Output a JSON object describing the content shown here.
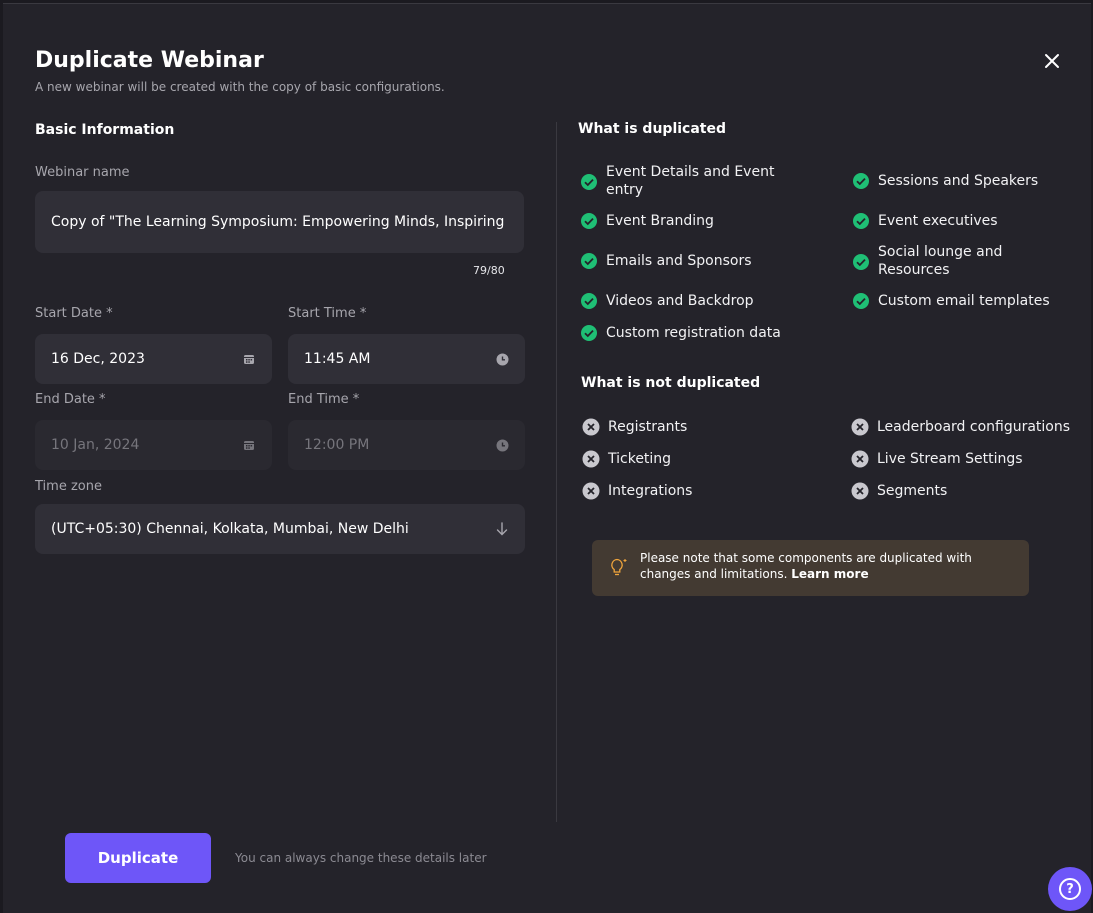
{
  "modal": {
    "title": "Duplicate Webinar",
    "subtitle": "A new webinar will be created with the copy of basic configurations."
  },
  "basic_info": {
    "heading": "Basic Information",
    "webinar_name_label": "Webinar name",
    "webinar_name_value": "Copy of \"The Learning Symposium: Empowering Minds, Inspiring Futu",
    "char_counter": "79/80",
    "start_date_label": "Start Date *",
    "start_date_value": "16 Dec, 2023",
    "start_time_label": "Start Time *",
    "start_time_value": "11:45 AM",
    "end_date_label": "End Date *",
    "end_date_value": "10 Jan, 2024",
    "end_time_label": "End Time *",
    "end_time_value": "12:00 PM",
    "timezone_label": "Time zone",
    "timezone_value": "(UTC+05:30) Chennai, Kolkata, Mumbai, New Delhi"
  },
  "duplicated": {
    "heading": "What is duplicated",
    "items": [
      "Event Details and Event entry",
      "Sessions and Speakers",
      "Event Branding",
      "Event executives",
      "Emails and Sponsors",
      "Social lounge and Resources",
      "Videos and Backdrop",
      "Custom email templates",
      "Custom registration data"
    ]
  },
  "not_duplicated": {
    "heading": "What is not duplicated",
    "items": [
      "Registrants",
      "Leaderboard configurations",
      "Ticketing",
      "Live Stream Settings",
      "Integrations",
      "Segments"
    ]
  },
  "note": {
    "text": "Please note that some components are duplicated with changes and limitations.",
    "link": "Learn more"
  },
  "footer": {
    "duplicate_button": "Duplicate",
    "helper_text": "You can always change these details later",
    "help_icon": "?"
  },
  "colors": {
    "accent": "#6e56f8",
    "check": "#1fbf75",
    "background": "#24232a"
  }
}
